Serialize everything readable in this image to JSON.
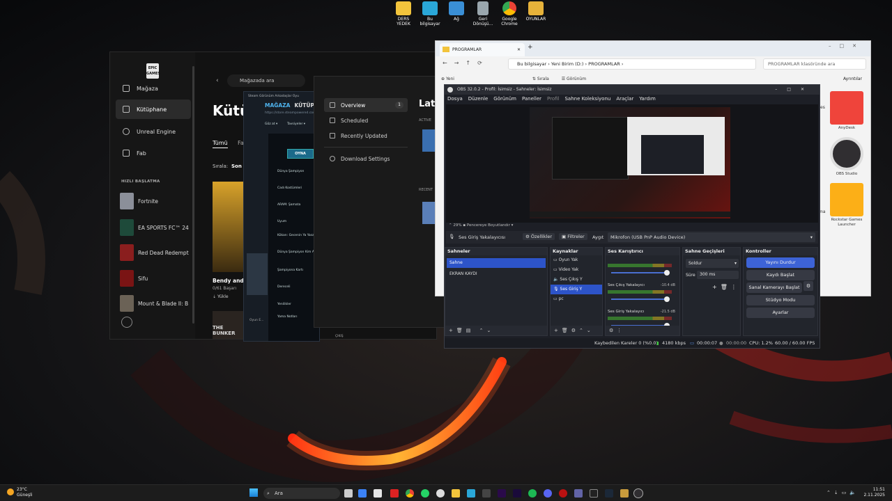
{
  "desktop": {
    "icons": [
      "DERS YEDEK",
      "Bu bilgisayar",
      "Ağ",
      "Geri Dönüşü...",
      "Google Chrome",
      "OYUNLAR"
    ]
  },
  "epic": {
    "nav": [
      "Mağaza",
      "Kütüphane",
      "Unreal Engine",
      "Fab"
    ],
    "section": "HIZLI BAŞLATMA",
    "games": [
      "Fortnite",
      "EA SPORTS FC™ 24",
      "Red Dead Redempt",
      "Sifu",
      "Mount & Blade II: B"
    ],
    "search_placeholder": "Mağazada ara",
    "title": "Kütü",
    "filter_tab": "Tümü",
    "filter_tab2": "Fa",
    "sort_label": "Sırala:",
    "sort_value": "Son S",
    "card_title": "Bendy and th",
    "card_progress": "0/61 Başarı",
    "card_action": "Yükle",
    "card2_title": "THE BUNKER"
  },
  "steam": {
    "menu": "Steam  Görünüm  Arkadaşlar  Oyu",
    "tab_store": "MAĞAZA",
    "tab_library": "KÜTÜPH",
    "url": "https://store.steampowered.com/",
    "filters": [
      "Göz at ▾",
      "Tavsiyeler ▾"
    ],
    "play": "OYNA",
    "items": [
      "Dünya Şampiyon",
      "Cadı Kostümleri",
      "ARAM: Şamata",
      "Uyum",
      "Kökan: Gecenin Ya Yasası",
      "Dünya Şampiyon Kim Alır",
      "Şampiyona Kartı",
      "Dereceli",
      "Yenilikler",
      "Yama Notları"
    ],
    "bottom": "Oyun E...",
    "bottom2": "ÇIKIŞ"
  },
  "downloads": {
    "items": [
      "Overview",
      "Scheduled",
      "Recently Updated",
      "Download Settings"
    ],
    "badge": "1",
    "heading": "Late",
    "active_label": "ACTIVE",
    "recent_label": "RECENT"
  },
  "explorer": {
    "tab": "PROGRAMLAR",
    "breadcrumb": [
      "Bu bilgisayar",
      "Yeni Birim (D:)",
      "PROGRAMLAR"
    ],
    "search_placeholder": "PROGRAMLAR klasöründe ara",
    "toolbar": [
      "Yeni",
      "Sırala",
      "Görünüm"
    ],
    "details": "Ayrıntılar",
    "apps": [
      "AnyDesk",
      "OBS Studio",
      "Rockstar Games Launcher"
    ],
    "partial_apps": [
      "es",
      "ma"
    ]
  },
  "obs": {
    "title": "OBS 32.0.2 - Profil: İsimsiz - Sahneler: İsimsiz",
    "menu": [
      "Dosya",
      "Düzenle",
      "Görünüm",
      "Paneller",
      "Profil",
      "Sahne Koleksiyonu",
      "Araçlar",
      "Yardım"
    ],
    "zoom": "29%",
    "fit": "Pencereye Boyutlandır",
    "source_name": "Ses Giriş Yakalayıcısı",
    "props_btn": "Özellikler",
    "filters_btn": "Filtreler",
    "device_label": "Aygıt",
    "device_value": "Mikrofon (USB PnP Audio Device)",
    "scenes_title": "Sahneler",
    "scenes": [
      "Sahne",
      "EKRAN KAYDI"
    ],
    "sources_title": "Kaynaklar",
    "sources": [
      "Oyun Yak",
      "Video Yak",
      "Ses Çıkış Y",
      "Ses Giriş Y",
      "pc"
    ],
    "mixer_title": "Ses Karıştırıcı",
    "mixer": [
      {
        "name": "",
        "db": ""
      },
      {
        "name": "Ses Çıkış Yakalayıcı",
        "db": "-10.4 dB"
      },
      {
        "name": "Ses Giriş Yakalayıcı",
        "db": "-21.5 dB"
      }
    ],
    "transitions_title": "Sahne Geçişleri",
    "transition": "Soldur",
    "duration_label": "Süre",
    "duration": "300 ms",
    "controls_title": "Kontroller",
    "controls": [
      "Yayını Durdur",
      "Kaydı Başlat",
      "Sanal Kamerayı Başlat",
      "Stüdyo Modu",
      "Ayarlar"
    ],
    "status": {
      "dropped": "Kaybedilen Kareler 0 (%0.0)",
      "bitrate": "4180 kbps",
      "live_time": "00:00:07",
      "rec_time": "00:00:00",
      "cpu": "CPU: 1.2%",
      "fps": "60.00 / 60.00 FPS"
    }
  },
  "taskbar": {
    "temp": "23°C",
    "weather": "Güneşli",
    "search": "Ara",
    "time": "11:51",
    "date": "2.11.2025"
  },
  "colors": {
    "obs_accent": "#3d63d6",
    "wallpaper_lava": "#ff3a1a"
  }
}
